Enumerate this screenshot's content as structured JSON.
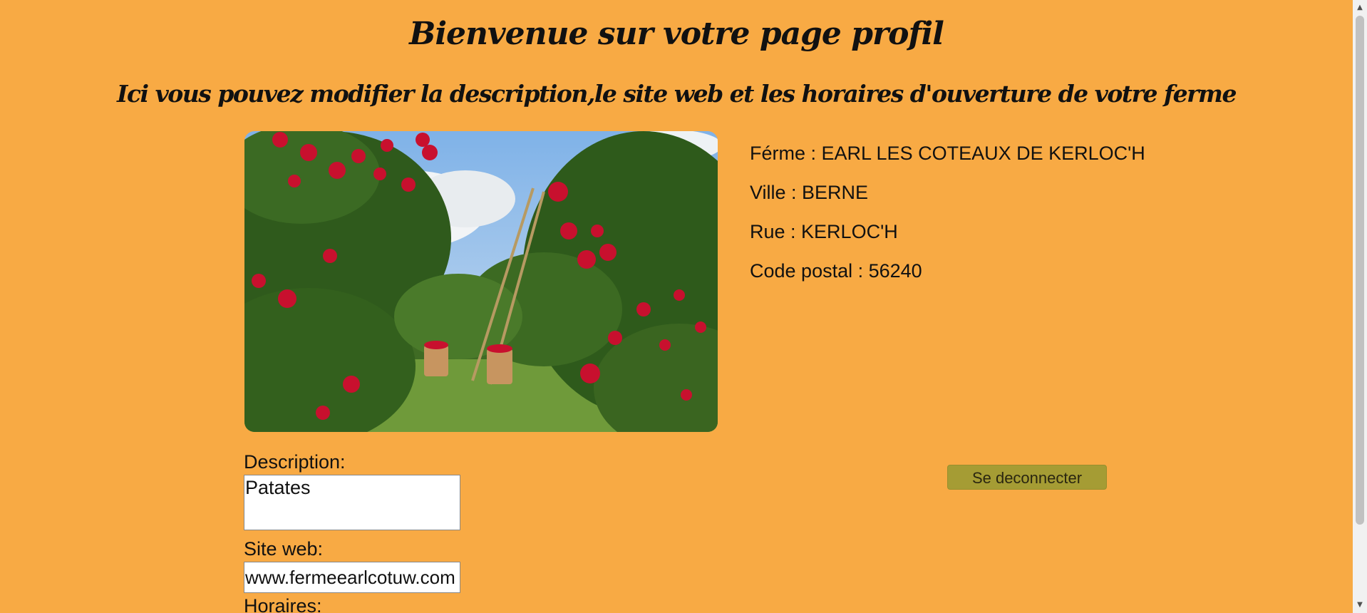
{
  "header": {
    "title": "Bienvenue sur votre page profil",
    "subtitle": "Ici vous pouvez modifier la description,le site web et les horaires d'ouverture de votre ferme"
  },
  "farm": {
    "name_row": "Férme : EARL LES COTEAUX DE KERLOC'H",
    "city_row": "Ville : BERNE",
    "street_row": "Rue : KERLOC'H",
    "postal_row": "Code postal : 56240"
  },
  "form": {
    "description_label": "Description:",
    "description_value": "Patates",
    "website_label": "Site web:",
    "website_value": "www.fermeearlcotuw.com",
    "hours_label": "Horaires:"
  },
  "actions": {
    "logout_label": "Se deconnecter"
  },
  "colors": {
    "background": "#f8aa44",
    "button": "#a59c34"
  },
  "icons": {
    "scroll_up": "triangle-up-icon",
    "scroll_down": "triangle-down-icon"
  }
}
